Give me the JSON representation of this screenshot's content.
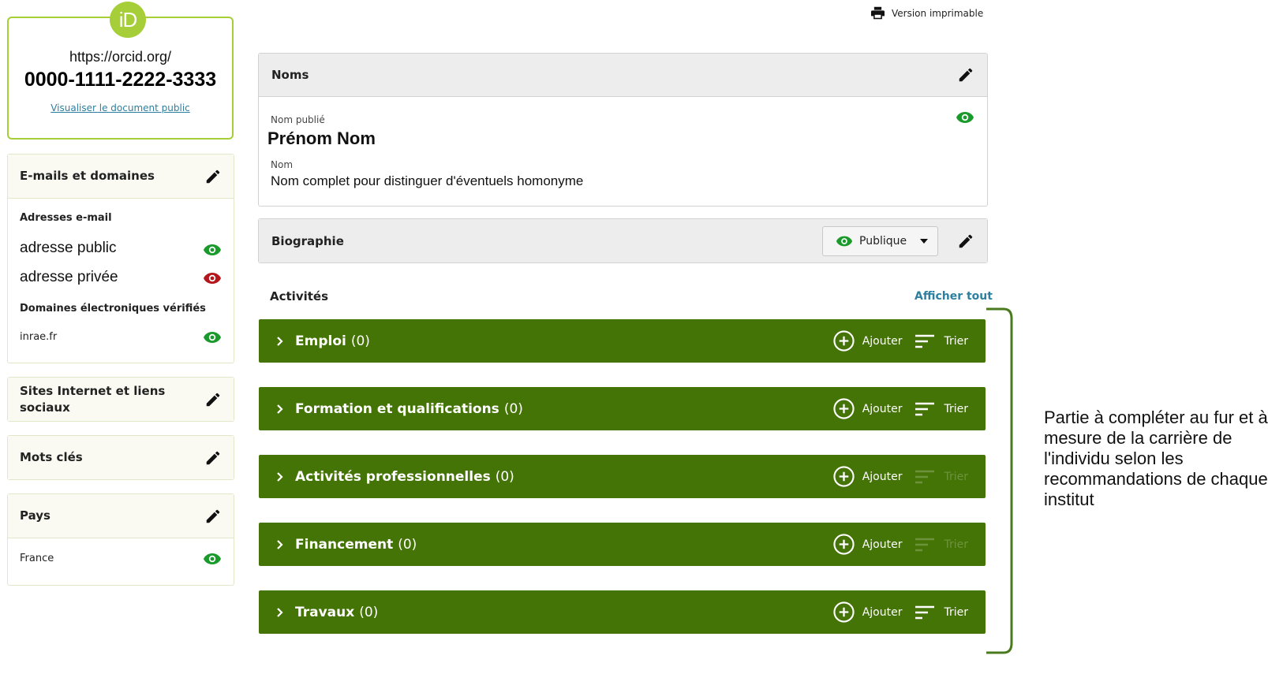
{
  "orcid": {
    "logo_text": "iD",
    "url": "https://orcid.org/",
    "number": "0000-1111-2222-3333",
    "public_link": "Visualiser le document public"
  },
  "sidebar": {
    "emails": {
      "title": "E-mails et domaines",
      "addresses_label": "Adresses e-mail",
      "public_address": "adresse public",
      "private_address": "adresse privée",
      "domains_label": "Domaines électroniques vérifiés",
      "domain": "inrae.fr"
    },
    "websites": {
      "title": "Sites Internet et liens sociaux"
    },
    "keywords": {
      "title": "Mots clés"
    },
    "country": {
      "title": "Pays",
      "value": "France"
    }
  },
  "toolbar": {
    "print_label": "Version imprimable"
  },
  "names": {
    "title": "Noms",
    "published_label": "Nom publié",
    "published_value": "Prénom Nom",
    "name_label": "Nom",
    "name_value": "Nom complet pour distinguer d'éventuels homonyme"
  },
  "biography": {
    "title": "Biographie",
    "visibility": "Publique"
  },
  "activities": {
    "title": "Activités",
    "show_all": "Afficher tout",
    "add_label": "Ajouter",
    "sort_label": "Trier",
    "sections": [
      {
        "name": "Emploi",
        "count": "(0)",
        "sort_enabled": true
      },
      {
        "name": "Formation et qualifications",
        "count": "(0)",
        "sort_enabled": true
      },
      {
        "name": "Activités professionnelles",
        "count": "(0)",
        "sort_enabled": false
      },
      {
        "name": "Financement",
        "count": "(0)",
        "sort_enabled": false
      },
      {
        "name": "Travaux",
        "count": "(0)",
        "sort_enabled": true
      }
    ]
  },
  "annotation": "Partie à compléter au fur et à mesure de la carrière de l'individu selon les recommandations de chaque institut",
  "colors": {
    "orcid_green": "#a6ce39",
    "section_green": "#447405",
    "visible_eye": "#1a9a2a",
    "private_eye": "#b4161b",
    "link_blue": "#2e7f9f"
  }
}
